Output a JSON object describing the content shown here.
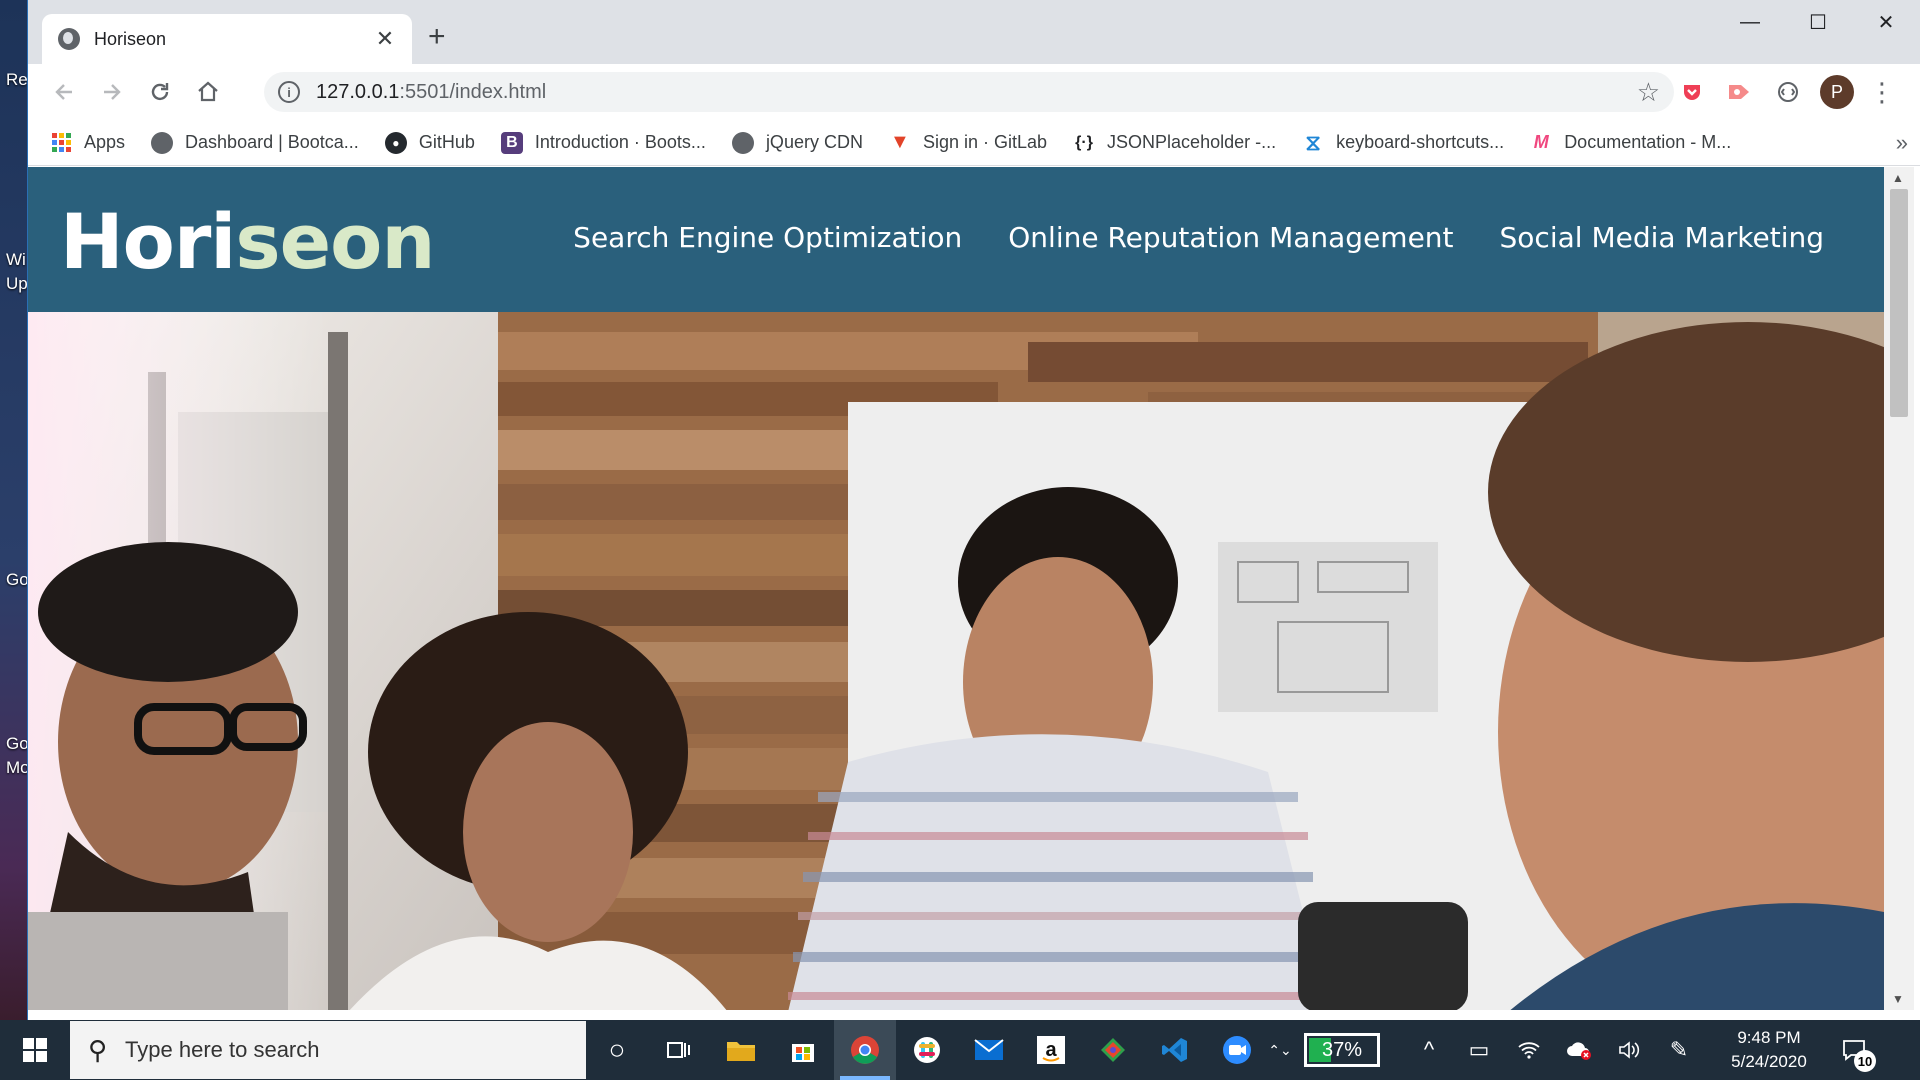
{
  "desktop": {
    "labels": [
      "Re",
      "Wi",
      "Up",
      "Go",
      "Go",
      "Mo"
    ]
  },
  "browser": {
    "tab": {
      "title": "Horiseon",
      "close": "✕"
    },
    "new_tab": "+",
    "window_controls": {
      "minimize": "—",
      "maximize": "☐",
      "close": "✕"
    },
    "url": {
      "host": "127.0.0.1",
      "rest": ":5501/index.html"
    },
    "avatar_letter": "P",
    "bookmarks": [
      {
        "label": "Apps",
        "icon": "apps-icon"
      },
      {
        "label": "Dashboard | Bootca...",
        "icon": "globe-icon"
      },
      {
        "label": "GitHub",
        "icon": "github-icon"
      },
      {
        "label": "Introduction · Boots...",
        "icon": "bootstrap-icon"
      },
      {
        "label": "jQuery CDN",
        "icon": "globe-icon"
      },
      {
        "label": "Sign in · GitLab",
        "icon": "gitlab-icon"
      },
      {
        "label": "JSONPlaceholder -...",
        "icon": "json-icon"
      },
      {
        "label": "keyboard-shortcuts...",
        "icon": "vscode-icon"
      },
      {
        "label": "Documentation - M...",
        "icon": "docs-icon"
      }
    ],
    "bookmarks_more": "»"
  },
  "site": {
    "logo_main": "Hori",
    "logo_accent": "seon",
    "nav": [
      "Search Engine Optimization",
      "Online Reputation Management",
      "Social Media Marketing"
    ],
    "hero_alt": "Team working together at a table"
  },
  "taskbar": {
    "search_placeholder": "Type here to search",
    "battery_percent": "37%",
    "battery_level": 0.37,
    "time": "9:48 PM",
    "date": "5/24/2020",
    "notification_count": "10"
  },
  "colors": {
    "header_bg": "#2a607c",
    "logo_accent": "#d9e9c8",
    "taskbar_bg": "#1f2d3a"
  }
}
